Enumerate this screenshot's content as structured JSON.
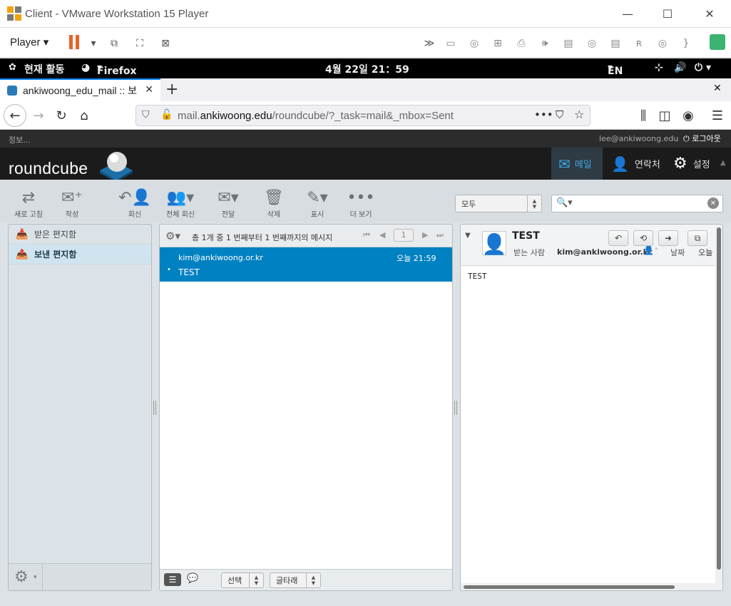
{
  "vmware": {
    "title": "Client - VMware Workstation 15 Player",
    "player_label": "Player"
  },
  "gnome": {
    "activities": "현재 활동",
    "app": "Firefox",
    "clock": "4월 22일  21：59",
    "lang": "EN"
  },
  "firefox": {
    "tab_title": "ankiwoong_edu_mail :: 보",
    "url_prefix": "mail.",
    "url_domain": "ankiwoong.edu",
    "url_path": "/roundcube/?_task=mail&_mbox=Sent"
  },
  "roundcube": {
    "info": "정보...",
    "user": "lee@ankiwoong.edu",
    "logout": "로그아웃",
    "logo": "roundcube",
    "nav": {
      "mail": "메일",
      "contacts": "연락처",
      "settings": "설정"
    },
    "toolbar": {
      "refresh": "새로 고침",
      "compose": "작성",
      "reply": "회신",
      "reply_all": "전체 회신",
      "forward": "전달",
      "delete": "삭제",
      "mark": "표시",
      "more": "더 보기"
    },
    "search_filter": "모두",
    "folders": [
      {
        "label": "받은 편지함",
        "selected": false
      },
      {
        "label": "보낸 편지함",
        "selected": true
      }
    ],
    "list_header": "총 1개 중 1 번째부터 1 번째까지의 메시지",
    "page": "1",
    "messages": [
      {
        "to": "kim@ankiwoong.or.kr",
        "date": "오늘 21:59",
        "subject": "TEST"
      }
    ],
    "footer": {
      "select": "선택",
      "threads": "글타래"
    },
    "preview": {
      "subject": "TEST",
      "to_label": "받는 사람",
      "to": "kim@ankiwoong.or.kr",
      "date_label": "날짜",
      "date": "오늘",
      "body": "TEST"
    }
  }
}
